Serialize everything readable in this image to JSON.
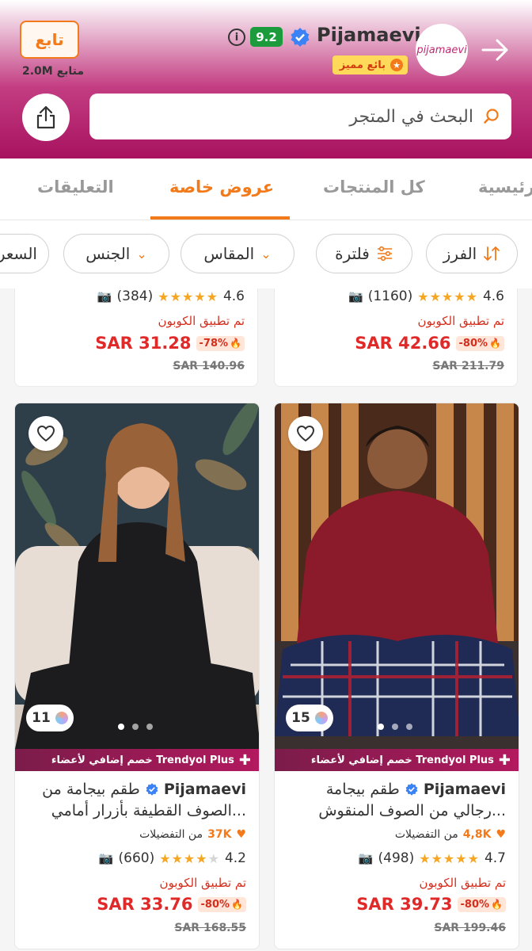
{
  "header": {
    "follow_label": "تابع",
    "followers": "2.0M متابع",
    "store_name": "Pijamaevi",
    "rating": "9.2",
    "seller_badge": "بائع مميز",
    "logo_text": "pijamaevi"
  },
  "search": {
    "placeholder": "البحث في المتجر"
  },
  "tabs": [
    {
      "label": "رئيسية"
    },
    {
      "label": "كل المنتجات"
    },
    {
      "label": "عروض خاصة"
    },
    {
      "label": "التعليقات"
    }
  ],
  "filters": [
    {
      "label": "الفرز"
    },
    {
      "label": "فلترة"
    },
    {
      "label": "المقاس"
    },
    {
      "label": "الجنس"
    },
    {
      "label": "السعر"
    }
  ],
  "top_products": [
    {
      "rating": "4.6",
      "count": "(1160)",
      "coupon": "تم تطبيق الكوبون",
      "price": "SAR 42.66",
      "discount": "-80%",
      "old_price": "SAR 211.79"
    },
    {
      "rating": "4.6",
      "count": "(384)",
      "coupon": "تم تطبيق الكوبون",
      "price": "SAR 31.28",
      "discount": "-78%",
      "old_price": "SAR 140.96"
    }
  ],
  "products": [
    {
      "images": "15",
      "plus_text": "خصم إضافي لأعضاء Trendyol Plus",
      "brand": "Pijamaevi",
      "title1": "طقم بيجامة",
      "title2": "رجالي من الصوف المنقوش...",
      "fav_count": "4,8K",
      "fav_label": "من التفضيلات",
      "rating": "4.7",
      "count": "(498)",
      "coupon": "تم تطبيق الكوبون",
      "price": "SAR 39.73",
      "discount": "-80%",
      "old_price": "SAR 199.46"
    },
    {
      "images": "11",
      "plus_text": "خصم إضافي لأعضاء Trendyol Plus",
      "brand": "Pijamaevi",
      "title1": "طقم بيجامة من",
      "title2": "الصوف القطيفة بأزرار أمامي...",
      "fav_count": "37K",
      "fav_label": "من التفضيلات",
      "rating": "4.2",
      "count": "(660)",
      "coupon": "تم تطبيق الكوبون",
      "price": "SAR 33.76",
      "discount": "-80%",
      "old_price": "SAR 168.55"
    }
  ]
}
